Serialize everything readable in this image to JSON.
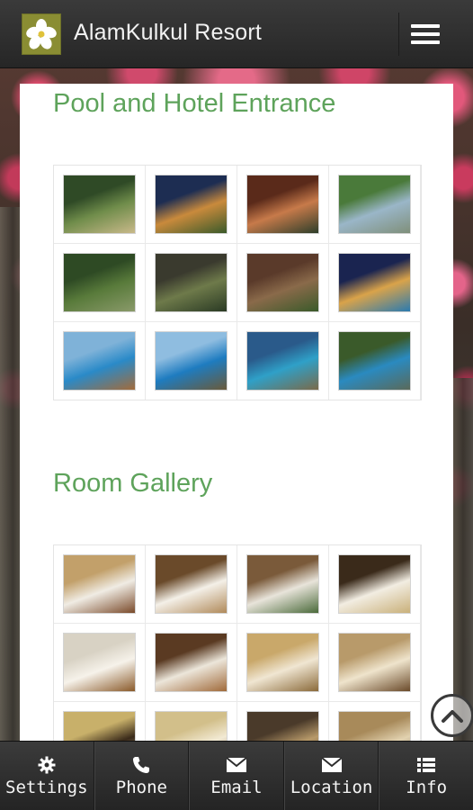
{
  "header": {
    "title": "AlamKulkul Resort",
    "logo_icon": "frangipani-flower-icon",
    "menu_icon": "hamburger-menu-icon"
  },
  "sections": [
    {
      "title": "Pool and Hotel Entrance",
      "thumbnails": [
        {
          "colors": [
            "#2f4a26",
            "#6f8c4a",
            "#c9b98a"
          ]
        },
        {
          "colors": [
            "#1d2d52",
            "#c98a3c",
            "#3a5a2a"
          ]
        },
        {
          "colors": [
            "#5a2a1a",
            "#c77a4a",
            "#2d3e2a"
          ]
        },
        {
          "colors": [
            "#4a7a3a",
            "#9ab6c8",
            "#7f8f7a"
          ]
        },
        {
          "colors": [
            "#2e4a24",
            "#587a3a",
            "#8a9a6a"
          ]
        },
        {
          "colors": [
            "#3a3a2e",
            "#6e7a4a",
            "#2a3a24"
          ]
        },
        {
          "colors": [
            "#5a3a2a",
            "#8a6a4a",
            "#3a5a2a"
          ]
        },
        {
          "colors": [
            "#1a2450",
            "#d9a34a",
            "#2a7ab0"
          ]
        },
        {
          "colors": [
            "#7fb2d8",
            "#2a8ac8",
            "#a36b3a"
          ]
        },
        {
          "colors": [
            "#8fbde0",
            "#1e7cc0",
            "#6a5a3a"
          ]
        },
        {
          "colors": [
            "#2a5a8a",
            "#2fa0c8",
            "#7a6a4a"
          ]
        },
        {
          "colors": [
            "#3a5a2a",
            "#2a8ac0",
            "#5a6a5a"
          ]
        }
      ]
    },
    {
      "title": "Room Gallery",
      "thumbnails": [
        {
          "colors": [
            "#c2a06a",
            "#f0ece4",
            "#7a4a2a"
          ]
        },
        {
          "colors": [
            "#6a4a2a",
            "#f4f0e8",
            "#b08a5a"
          ]
        },
        {
          "colors": [
            "#7a5a3a",
            "#e8e4da",
            "#4a6a3a"
          ]
        },
        {
          "colors": [
            "#3a2a1a",
            "#f2ede2",
            "#c9b07a"
          ]
        },
        {
          "colors": [
            "#d8d2c4",
            "#f6f2ea",
            "#8a5a2a"
          ]
        },
        {
          "colors": [
            "#5a3a22",
            "#ece6da",
            "#a06a3a"
          ]
        },
        {
          "colors": [
            "#c9a86a",
            "#f0e6d2",
            "#8a6a3a"
          ]
        },
        {
          "colors": [
            "#b89a6a",
            "#efe4cc",
            "#6a4a2a"
          ]
        },
        {
          "colors": [
            "#c8b06a",
            "#3a2a1a",
            "#e8d8a8"
          ]
        },
        {
          "colors": [
            "#d2bf8a",
            "#f2ead4",
            "#7a5a3a"
          ]
        },
        {
          "colors": [
            "#4a3a2a",
            "#b89a6a",
            "#2a2018"
          ]
        },
        {
          "colors": [
            "#a88a5a",
            "#e2d2b0",
            "#5a4a3a"
          ]
        }
      ]
    }
  ],
  "scroll_top_icon": "chevron-up-circle-icon",
  "bottom_nav": [
    {
      "label": "Settings",
      "icon": "gear-icon"
    },
    {
      "label": "Phone",
      "icon": "phone-icon"
    },
    {
      "label": "Email",
      "icon": "envelope-icon"
    },
    {
      "label": "Location",
      "icon": "envelope-icon"
    },
    {
      "label": "Info",
      "icon": "list-icon"
    }
  ]
}
